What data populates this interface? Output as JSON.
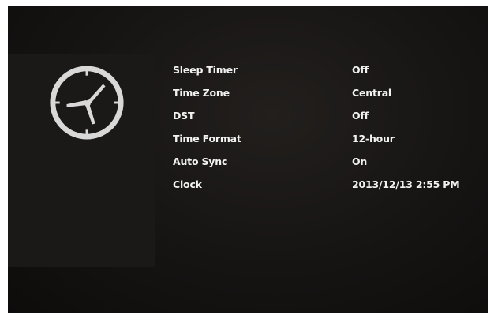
{
  "settings": [
    {
      "label": "Sleep Timer",
      "value": "Off"
    },
    {
      "label": "Time Zone",
      "value": "Central"
    },
    {
      "label": "DST",
      "value": "Off"
    },
    {
      "label": "Time Format",
      "value": "12-hour"
    },
    {
      "label": "Auto Sync",
      "value": "On"
    },
    {
      "label": "Clock",
      "value": "2013/12/13 2:55 PM"
    }
  ],
  "icons": {
    "clock": "clock-icon"
  },
  "colors": {
    "background": "#161413",
    "panel": "#1b1918",
    "text": "#f2f2f2"
  }
}
